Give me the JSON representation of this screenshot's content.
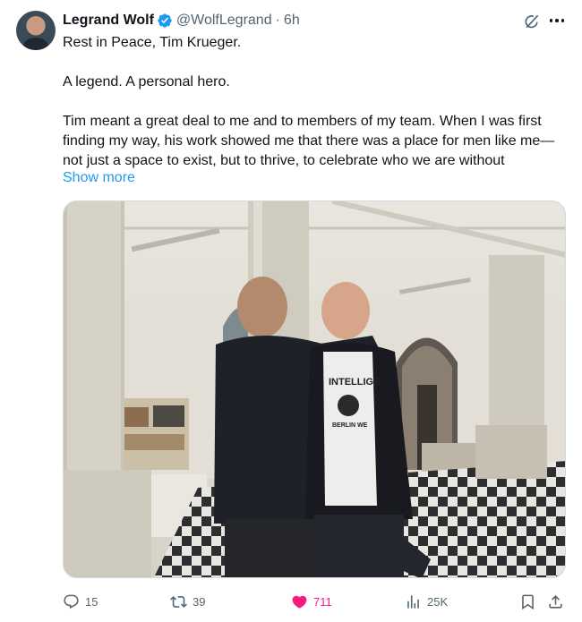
{
  "author": {
    "name": "Legrand Wolf",
    "handle": "@WolfLegrand",
    "separator": "·",
    "time": "6h"
  },
  "tweet": {
    "line1": "Rest in Peace, Tim Krueger.",
    "line2": "A legend. A personal hero.",
    "line3": "Tim meant a great deal to me and to members of my team. When I was first finding my way, his work showed me that there was a place for men like me—not just a space to exist, but to thrive, to celebrate who we are without",
    "show_more": "Show more"
  },
  "media": {
    "shirt_text_top": "INTELLIGE",
    "shirt_text_mid": "BERLIN WE"
  },
  "actions": {
    "replies": "15",
    "reposts": "39",
    "likes": "711",
    "views": "25K"
  },
  "colors": {
    "accent": "#1d9bf0",
    "like": "#f91880",
    "muted": "#536471",
    "text": "#0f1419",
    "verified": "#1d9bf0"
  },
  "icons": [
    "grok-icon",
    "more-icon",
    "verified-icon",
    "reply-icon",
    "repost-icon",
    "like-icon",
    "views-icon",
    "bookmark-icon",
    "share-icon"
  ]
}
